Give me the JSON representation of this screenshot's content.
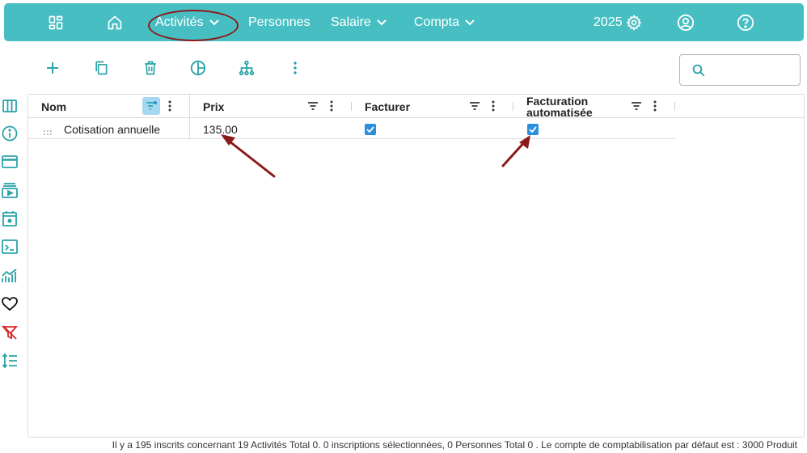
{
  "nav": {
    "items": [
      {
        "label": "Activités",
        "has_dropdown": true
      },
      {
        "label": "Personnes",
        "has_dropdown": false
      },
      {
        "label": "Salaire",
        "has_dropdown": true
      },
      {
        "label": "Compta",
        "has_dropdown": true
      }
    ],
    "year": "2025",
    "icons": [
      "dashboard-icon",
      "home-icon",
      "settings-gear-icon",
      "user-account-icon",
      "help-icon"
    ]
  },
  "toolbar": {
    "icons": [
      "add-icon",
      "duplicate-icon",
      "delete-icon",
      "pie-chart-icon",
      "hierarchy-icon",
      "more-vertical-icon"
    ],
    "search_placeholder": ""
  },
  "sidebar": {
    "icons": [
      "columns-icon",
      "info-icon",
      "credit-card-icon",
      "video-library-icon",
      "calendar-icon",
      "terminal-icon",
      "analytics-icon",
      "heart-icon",
      "filter-off-icon",
      "sort-lines-icon"
    ]
  },
  "grid": {
    "columns": [
      {
        "label": "Nom",
        "filter_active": true
      },
      {
        "label": "Prix",
        "filter_active": false
      },
      {
        "label": "Facturer",
        "filter_active": false
      },
      {
        "label": "Facturation automatisée",
        "filter_active": false
      }
    ],
    "rows": [
      {
        "nom": "Cotisation annuelle",
        "prix": "135.00",
        "facturer": true,
        "facturation_auto": true
      }
    ]
  },
  "footer_text": "Il y a 195 inscrits concernant 19 Activités Total 0. 0 inscriptions sélectionnées, 0 Personnes Total 0 . Le compte de comptabilisation par défaut est : 3000 Produit",
  "colors": {
    "nav_bg": "#47bfc2",
    "accent_teal": "#2aa3a7",
    "checkbox_blue": "#2b8fdc",
    "annotation_red": "#8b1a1a",
    "filter_active_bg": "#a7d8f2"
  }
}
